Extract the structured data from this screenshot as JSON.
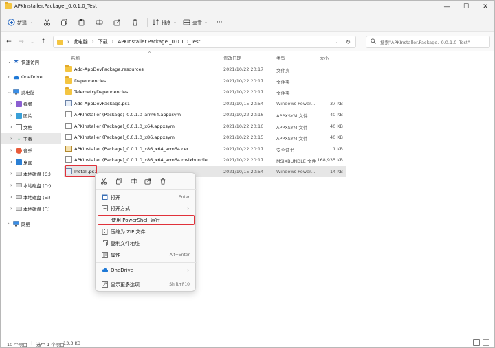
{
  "window": {
    "title": "APKInstaller.Package._0.0.1.0_Test",
    "min_glyph": "—",
    "max_glyph": "☐",
    "close_glyph": "✕"
  },
  "toolbar": {
    "new_label": "新建",
    "sort_label": "排序",
    "view_label": "查看",
    "more_label": "···"
  },
  "address": {
    "crumbs": [
      "此电脑",
      "下载",
      "APKInstaller.Package._0.0.1.0_Test"
    ],
    "search_placeholder": "搜索\"APKInstaller.Package._0.0.1.0_Test\""
  },
  "sidebar": {
    "items": [
      {
        "label": "快速访问"
      },
      {
        "label": "OneDrive"
      },
      {
        "label": "此电脑"
      },
      {
        "label": "视频"
      },
      {
        "label": "图片"
      },
      {
        "label": "文档"
      },
      {
        "label": "下载"
      },
      {
        "label": "音乐"
      },
      {
        "label": "桌面"
      },
      {
        "label": "本地磁盘 (C:)"
      },
      {
        "label": "本地磁盘 (D:)"
      },
      {
        "label": "本地磁盘 (E:)"
      },
      {
        "label": "本地磁盘 (F:)"
      },
      {
        "label": "网络"
      }
    ]
  },
  "columns": {
    "name": "名称",
    "date": "修改日期",
    "type": "类型",
    "size": "大小"
  },
  "files": [
    {
      "name": "Add-AppDevPackage.resources",
      "date": "2021/10/22 20:17",
      "type": "文件夹",
      "size": "",
      "kind": "folder"
    },
    {
      "name": "Dependencies",
      "date": "2021/10/22 20:17",
      "type": "文件夹",
      "size": "",
      "kind": "folder"
    },
    {
      "name": "TelemetryDependencies",
      "date": "2021/10/22 20:17",
      "type": "文件夹",
      "size": "",
      "kind": "folder"
    },
    {
      "name": "Add-AppDevPackage.ps1",
      "date": "2021/10/15 20:54",
      "type": "Windows Power...",
      "size": "37 KB",
      "kind": "ps1"
    },
    {
      "name": "APKInstaller (Package)_0.0.1.0_arm64.appxsym",
      "date": "2021/10/22 20:16",
      "type": "APPXSYM 文件",
      "size": "40 KB",
      "kind": "doc"
    },
    {
      "name": "APKInstaller (Package)_0.0.1.0_x64.appxsym",
      "date": "2021/10/22 20:16",
      "type": "APPXSYM 文件",
      "size": "40 KB",
      "kind": "doc"
    },
    {
      "name": "APKInstaller (Package)_0.0.1.0_x86.appxsym",
      "date": "2021/10/22 20:15",
      "type": "APPXSYM 文件",
      "size": "40 KB",
      "kind": "doc"
    },
    {
      "name": "APKInstaller (Package)_0.0.1.0_x86_x64_arm64.cer",
      "date": "2021/10/22 20:17",
      "type": "安全证书",
      "size": "1 KB",
      "kind": "cer"
    },
    {
      "name": "APKInstaller (Package)_0.0.1.0_x86_x64_arm64.msixbundle",
      "date": "2021/10/22 20:17",
      "type": "MSIXBUNDLE 文件",
      "size": "168,935 KB",
      "kind": "doc"
    },
    {
      "name": "Install.ps1",
      "date": "2021/10/15 20:54",
      "type": "Windows Power...",
      "size": "14 KB",
      "kind": "ps1"
    }
  ],
  "context_menu": {
    "items": [
      {
        "label": "打开",
        "shortcut": "Enter"
      },
      {
        "label": "打开方式",
        "arrow": "›"
      },
      {
        "label": "使用 PowerShell 运行"
      },
      {
        "label": "压缩为 ZIP 文件"
      },
      {
        "label": "复制文件地址"
      },
      {
        "label": "属性",
        "shortcut": "Alt+Enter"
      },
      {
        "label": "OneDrive",
        "arrow": "›"
      },
      {
        "label": "显示更多选项",
        "shortcut": "Shift+F10"
      }
    ]
  },
  "status": {
    "count": "10 个项目",
    "selected": "选中 1 个项目",
    "size": "13.3 KB"
  },
  "colors": {
    "highlight_border": "#e0313a",
    "folder": "#f4c541",
    "selection": "#e6e6e6"
  }
}
